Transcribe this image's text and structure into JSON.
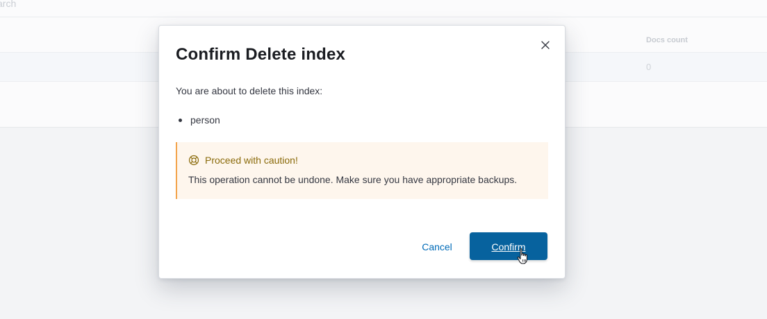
{
  "background": {
    "search_placeholder": "arch",
    "table": {
      "column_header": "Docs count",
      "cell_value": "0"
    }
  },
  "modal": {
    "title": "Confirm Delete index",
    "intro": "You are about to delete this index:",
    "indices": [
      "person"
    ],
    "callout": {
      "title": "Proceed with caution!",
      "body": "This operation cannot be undone. Make sure you have appropriate backups.",
      "icon": "help-icon",
      "color": "#f3a44c"
    },
    "cancel_label": "Cancel",
    "confirm_label": "Confirm",
    "accent_color": "#07629e"
  }
}
